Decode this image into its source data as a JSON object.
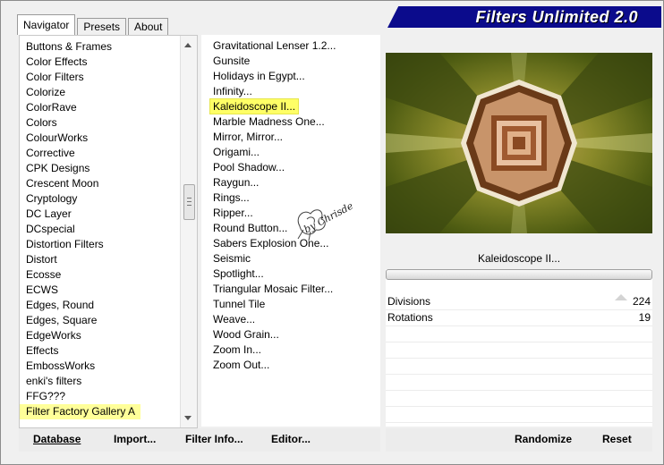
{
  "tabs": [
    {
      "label": "Navigator",
      "active": true
    },
    {
      "label": "Presets",
      "active": false
    },
    {
      "label": "About",
      "active": false
    }
  ],
  "brand": {
    "title": "Filters Unlimited 2.0",
    "color": "#0b0b8c"
  },
  "categories": {
    "items": [
      "Buttons & Frames",
      "Color Effects",
      "Color Filters",
      "Colorize",
      "ColorRave",
      "Colors",
      "ColourWorks",
      "Corrective",
      "CPK Designs",
      "Crescent Moon",
      "Cryptology",
      "DC Layer",
      "DCspecial",
      "Distortion Filters",
      "Distort",
      "Ecosse",
      "ECWS",
      "Edges, Round",
      "Edges, Square",
      "EdgeWorks",
      "Effects",
      "EmbossWorks",
      "enki's filters",
      "FFG???",
      "Filter Factory Gallery A"
    ],
    "selected_index": 24
  },
  "filters": {
    "items": [
      "Gravitational Lenser 1.2...",
      "Gunsite",
      "Holidays in Egypt...",
      "Infinity...",
      "Kaleidoscope II...",
      "Marble Madness One...",
      "Mirror, Mirror...",
      "Origami...",
      "Pool Shadow...",
      "Raygun...",
      "Rings...",
      "Ripper...",
      "Round Button...",
      "Sabers Explosion One...",
      "Seismic",
      "Spotlight...",
      "Triangular Mosaic Filter...",
      "Tunnel Tile",
      "Weave...",
      "Wood Grain...",
      "Zoom In...",
      "Zoom Out..."
    ],
    "selected_index": 4,
    "highlight_color": "#ffff66"
  },
  "watermark": {
    "text": "by Chrisde"
  },
  "preview": {
    "filter_name": "Kaleidoscope II..."
  },
  "parameters": [
    {
      "name": "Divisions",
      "value": "224"
    },
    {
      "name": "Rotations",
      "value": "19"
    }
  ],
  "buttons": {
    "database": "Database",
    "import": "Import...",
    "filter_info": "Filter Info...",
    "editor": "Editor...",
    "randomize": "Randomize",
    "reset": "Reset"
  }
}
